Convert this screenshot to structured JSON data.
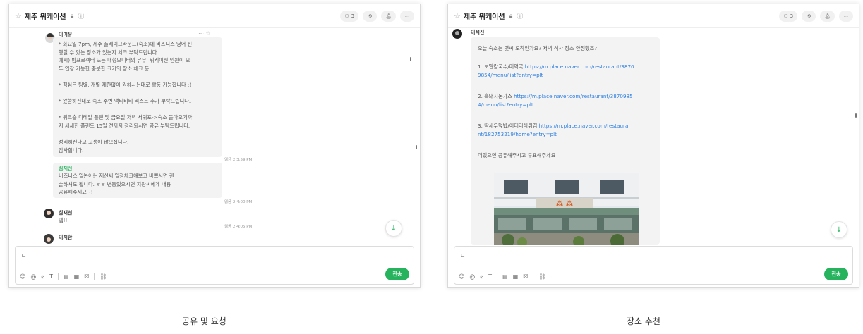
{
  "header": {
    "title": "제주 워케이션",
    "member_count": "3"
  },
  "left": {
    "top_name": "이미유",
    "bubble_lines": [
      "* 화요일 7pm, 제주 플레이그라운드(숙소)에 비즈니스 영어 진",
      "행할 수 있는 장소가 있는지 체크 부탁드립니다.",
      "예시) 빔프로젝터 또는 대형모니터의 유무, 워케이션 인원이 모",
      "두 입장 가능한 충분한 크기의 장소 체크 등",
      "",
      "* 점심은 팀별, 개별 제한없이 원하시는대로 활동 가능합니다 :)",
      "",
      "* 왔씀하신대로 숙소 주변 액티비티 리스트 추가 부탁드립니다.",
      "",
      "* 워크숍 디테일 플랜 및 금요일 저녁 서귀포->숙소 돌아오기까",
      "지 세세한 플랜도 15일 전까지 정리되시면 공유 부탁드립니다.",
      "",
      "정리하신다고 고생이 많으십니다.",
      "감사합니다."
    ],
    "time1": "읽음 2  3:59 PM",
    "reply_name": "심재선",
    "reply_lines": [
      "비즈니스 일본어는 재선씨 일정체크해보고 바쁘시면 랜",
      "슬하셔도 됩니다. ㅎㅎ 변동있으시면 지완씨에게 내용",
      "공유해주세요~!"
    ],
    "time2": "읽음 2  4:00 PM",
    "msg2_name": "심재선",
    "msg2_text": "넵!!",
    "time3": "읽음 2  4:05 PM",
    "msg3_name": "이지환",
    "compose_text": "ㄴ",
    "send_label": "전송",
    "caption": "공유 및 요청"
  },
  "right": {
    "top_name": "이석진",
    "intro": "오늘 숙소는 몇씨 도착인가요? 저녁 식사 장소 안정했죠?",
    "items": [
      {
        "label": "1. 보말칼국수/미역국 ",
        "link1": "https://m.place.naver.com/restaurant/3870",
        "link2": "9854/menu/list?entry=plt"
      },
      {
        "label": "2. 흑돼지돈가스 ",
        "link1": "https://m.place.naver.com/restaurant/3870985",
        "link2": "4/menu/list?entry=plt"
      },
      {
        "label": "3. 딱새우덮밥/이태리식튀김 ",
        "link1": "https://m.place.naver.com/restaura",
        "link2": "nt/182753219/home?entry=plt"
      }
    ],
    "outro": "더있으면 공유해주시고 투표해주세요",
    "compose_text": "ㄴ",
    "send_label": "전송",
    "caption": "장소 추천"
  }
}
